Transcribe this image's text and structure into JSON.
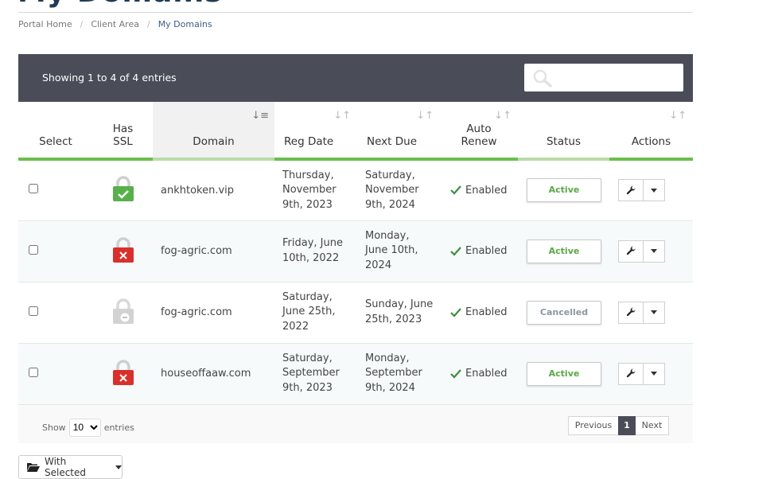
{
  "page": {
    "title": "My Domains"
  },
  "breadcrumb": [
    {
      "label": "Portal Home"
    },
    {
      "label": "Client Area"
    },
    {
      "label": "My Domains"
    }
  ],
  "table": {
    "info": "Showing 1 to 4 of 4 entries",
    "search_placeholder": "",
    "columns": {
      "select": "Select",
      "has_ssl_1": "Has",
      "has_ssl_2": "SSL",
      "domain": "Domain",
      "reg_date": "Reg Date",
      "next_due": "Next Due",
      "auto_renew_1": "Auto",
      "auto_renew_2": "Renew",
      "status": "Status",
      "actions": "Actions"
    },
    "rows": [
      {
        "ssl": "active",
        "domain": "ankhtoken.vip",
        "reg_date": [
          "Thursday,",
          "November",
          "9th, 2023"
        ],
        "next_due": [
          "Saturday,",
          "November",
          "9th, 2024"
        ],
        "auto_renew": "Enabled",
        "status": "Active"
      },
      {
        "ssl": "inactive",
        "domain": "fog-agric.com",
        "reg_date": [
          "Friday, June",
          "10th, 2022"
        ],
        "next_due": [
          "Monday,",
          "June 10th,",
          "2024"
        ],
        "auto_renew": "Enabled",
        "status": "Active"
      },
      {
        "ssl": "unknown",
        "domain": "fog-agric.com",
        "reg_date": [
          "Saturday,",
          "June 25th,",
          "2022"
        ],
        "next_due": [
          "Sunday, June",
          "25th, 2023"
        ],
        "auto_renew": "Enabled",
        "status": "Cancelled"
      },
      {
        "ssl": "inactive",
        "domain": "houseoffaaw.com",
        "reg_date": [
          "Saturday,",
          "September",
          "9th, 2023"
        ],
        "next_due": [
          "Monday,",
          "September",
          "9th, 2024"
        ],
        "auto_renew": "Enabled",
        "status": "Active"
      }
    ]
  },
  "footer": {
    "show_label": "Show",
    "page_size": "10",
    "entries_label": "entries",
    "previous": "Previous",
    "current_page": "1",
    "next": "Next"
  },
  "bulk": {
    "label": "With Selected"
  },
  "colors": {
    "header_bg": "#4a4d57",
    "accent_green": "#6abf4b",
    "ssl_ok": "#57b04a",
    "ssl_bad": "#d9302c",
    "ssl_unknown": "#c9c9c9"
  }
}
